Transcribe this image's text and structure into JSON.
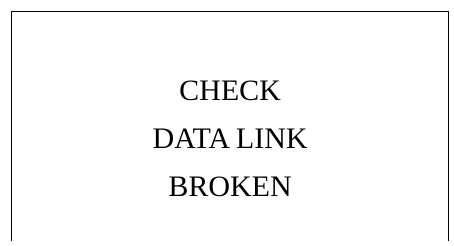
{
  "message": {
    "lines": [
      "CHECK",
      "DATA LINK",
      "BROKEN"
    ]
  },
  "colors": {
    "text": "#000000",
    "background": "#ffffff",
    "border": "#000000"
  }
}
